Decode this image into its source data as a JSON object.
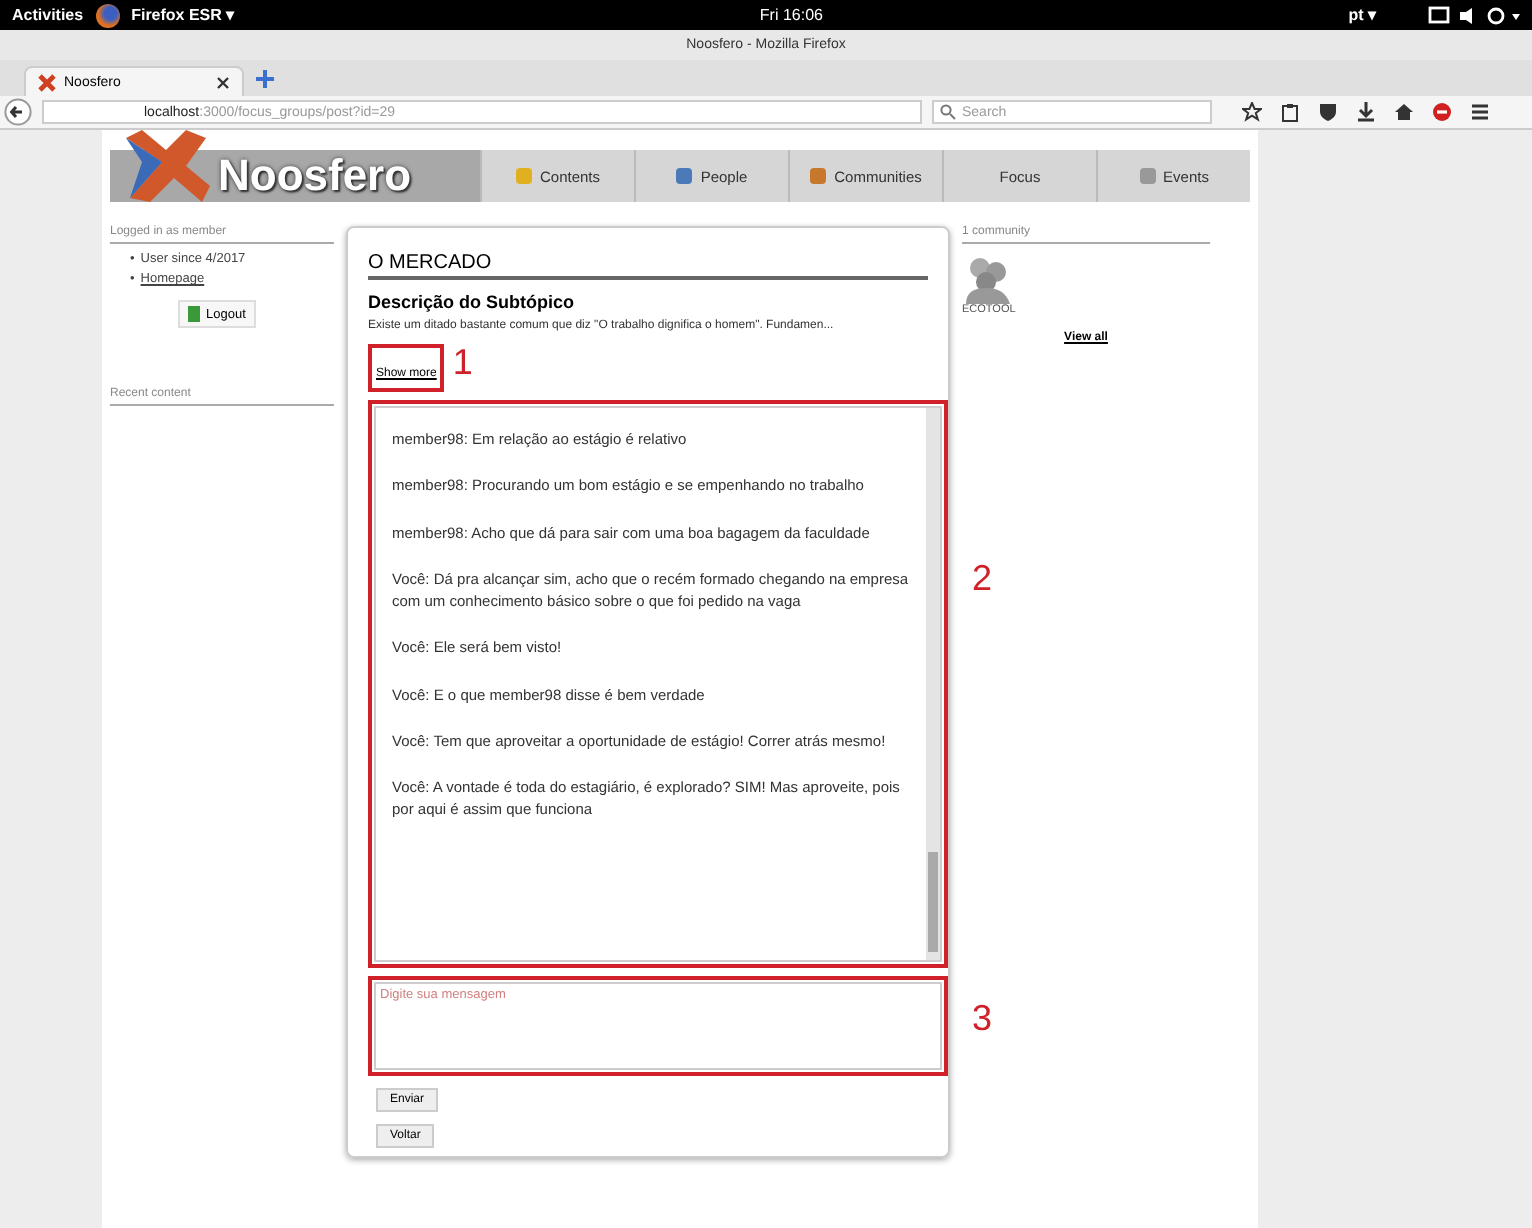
{
  "topbar": {
    "activities": "Activities",
    "app_menu": "Firefox ESR ▾",
    "clock": "Fri 16:06",
    "language": "pt ▾"
  },
  "window": {
    "title": "Noosfero - Mozilla Firefox"
  },
  "tabs": [
    {
      "label": "Noosfero",
      "selected": true
    }
  ],
  "address_bar": {
    "host": "localhost",
    "path": ":3000/focus_groups/post?id=29"
  },
  "search": {
    "placeholder": "Search"
  },
  "site": {
    "logo": "Noosfero",
    "nav": [
      {
        "label": "Contents"
      },
      {
        "label": "People"
      },
      {
        "label": "Communities"
      },
      {
        "label": "Focus"
      },
      {
        "label": "Events"
      }
    ]
  },
  "left_sidebar": {
    "login_title": "Logged in as member",
    "items": [
      {
        "marker": "•",
        "text": "User since 4/2017"
      },
      {
        "marker": "•",
        "text": "Homepage"
      }
    ],
    "logout": "Logout",
    "recent_title": "Recent content"
  },
  "right_sidebar": {
    "title": "1 community",
    "community": "ECOTOOL",
    "view_all": "View all"
  },
  "post": {
    "title": "O MERCADO",
    "subtitle": "Descrição do Subtópico",
    "summary": "Existe um ditado bastante comum que diz \"O trabalho dignifica o homem\". Fundamen...",
    "show_more": "Show more",
    "messages": [
      {
        "sender": "member98:",
        "text": "Em relação ao estágio é relativo"
      },
      {
        "sender": "member98:",
        "text": "Procurando um bom estágio e se empenhando no trabalho"
      },
      {
        "sender": "member98:",
        "text": "Acho que dá para sair com uma boa bagagem da faculdade"
      },
      {
        "sender": "Você:",
        "text": "Dá pra alcançar sim, acho que o recém formado chegando na empresa com um conhecimento básico sobre o que foi pedido na vaga"
      },
      {
        "sender": "Você:",
        "text": "Ele será bem visto!"
      },
      {
        "sender": "Você:",
        "text": "E o que member98 disse é bem verdade"
      },
      {
        "sender": "Você:",
        "text": "Tem que aproveitar a oportunidade de estágio! Correr atrás mesmo!"
      },
      {
        "sender": "Você:",
        "text": "A vontade é toda do estagiário, é explorado? SIM! Mas aproveite, pois por aqui é assim que funciona"
      }
    ],
    "message_placeholder": "Digite sua mensagem",
    "send": "Enviar",
    "back": "Voltar"
  },
  "annotations": [
    {
      "label": "1"
    },
    {
      "label": "2"
    },
    {
      "label": "3"
    }
  ]
}
